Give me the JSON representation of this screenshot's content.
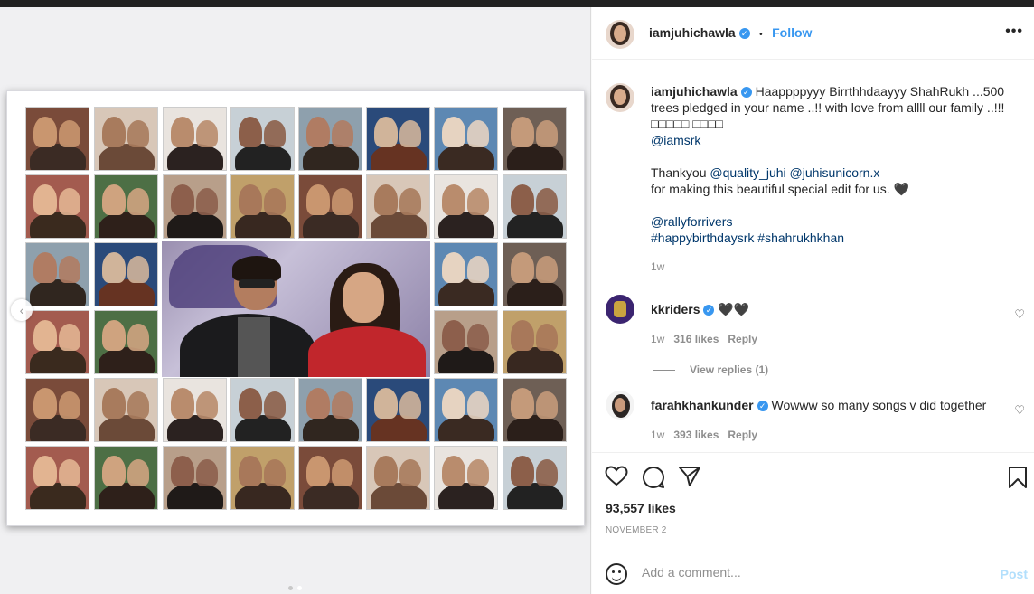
{
  "post": {
    "username": "iamjuhichawla",
    "follow_label": "Follow",
    "more_label": "•••",
    "separator": "•"
  },
  "caption": {
    "username": "iamjuhichawla",
    "line1": "Haappppyyy Birrthhdaayyy ShahRukh ...500 trees pledged in your name ..!! with love from allll our family ..!!! □□□□□ □□□□",
    "mention1": "@iamsrk",
    "thanks_prefix": "Thankyou ",
    "mention2": "@quality_juhi",
    "mention3": "@juhisunicorn.x",
    "thanks_suffix": "for making this beautiful special edit for us. 🖤",
    "mention4": "@rallyforrivers",
    "hashtags": "#happybirthdaysrk #shahrukhkhan",
    "time": "1w"
  },
  "comments": [
    {
      "username": "kkriders",
      "text": "🖤🖤",
      "time": "1w",
      "likes": "316 likes",
      "reply_label": "Reply",
      "view_replies": "View replies (1)"
    },
    {
      "username": "farahkhankunder",
      "text": "Wowww so many songs v did together",
      "time": "1w",
      "likes": "393 likes",
      "reply_label": "Reply"
    }
  ],
  "actions": {
    "likes": "93,557 likes",
    "date": "NOVEMBER 2"
  },
  "comment_box": {
    "placeholder": "Add a comment...",
    "post_label": "Post"
  },
  "colors": {
    "accent": "#3897f0",
    "link": "#00376b",
    "muted": "#8e8e8e"
  }
}
